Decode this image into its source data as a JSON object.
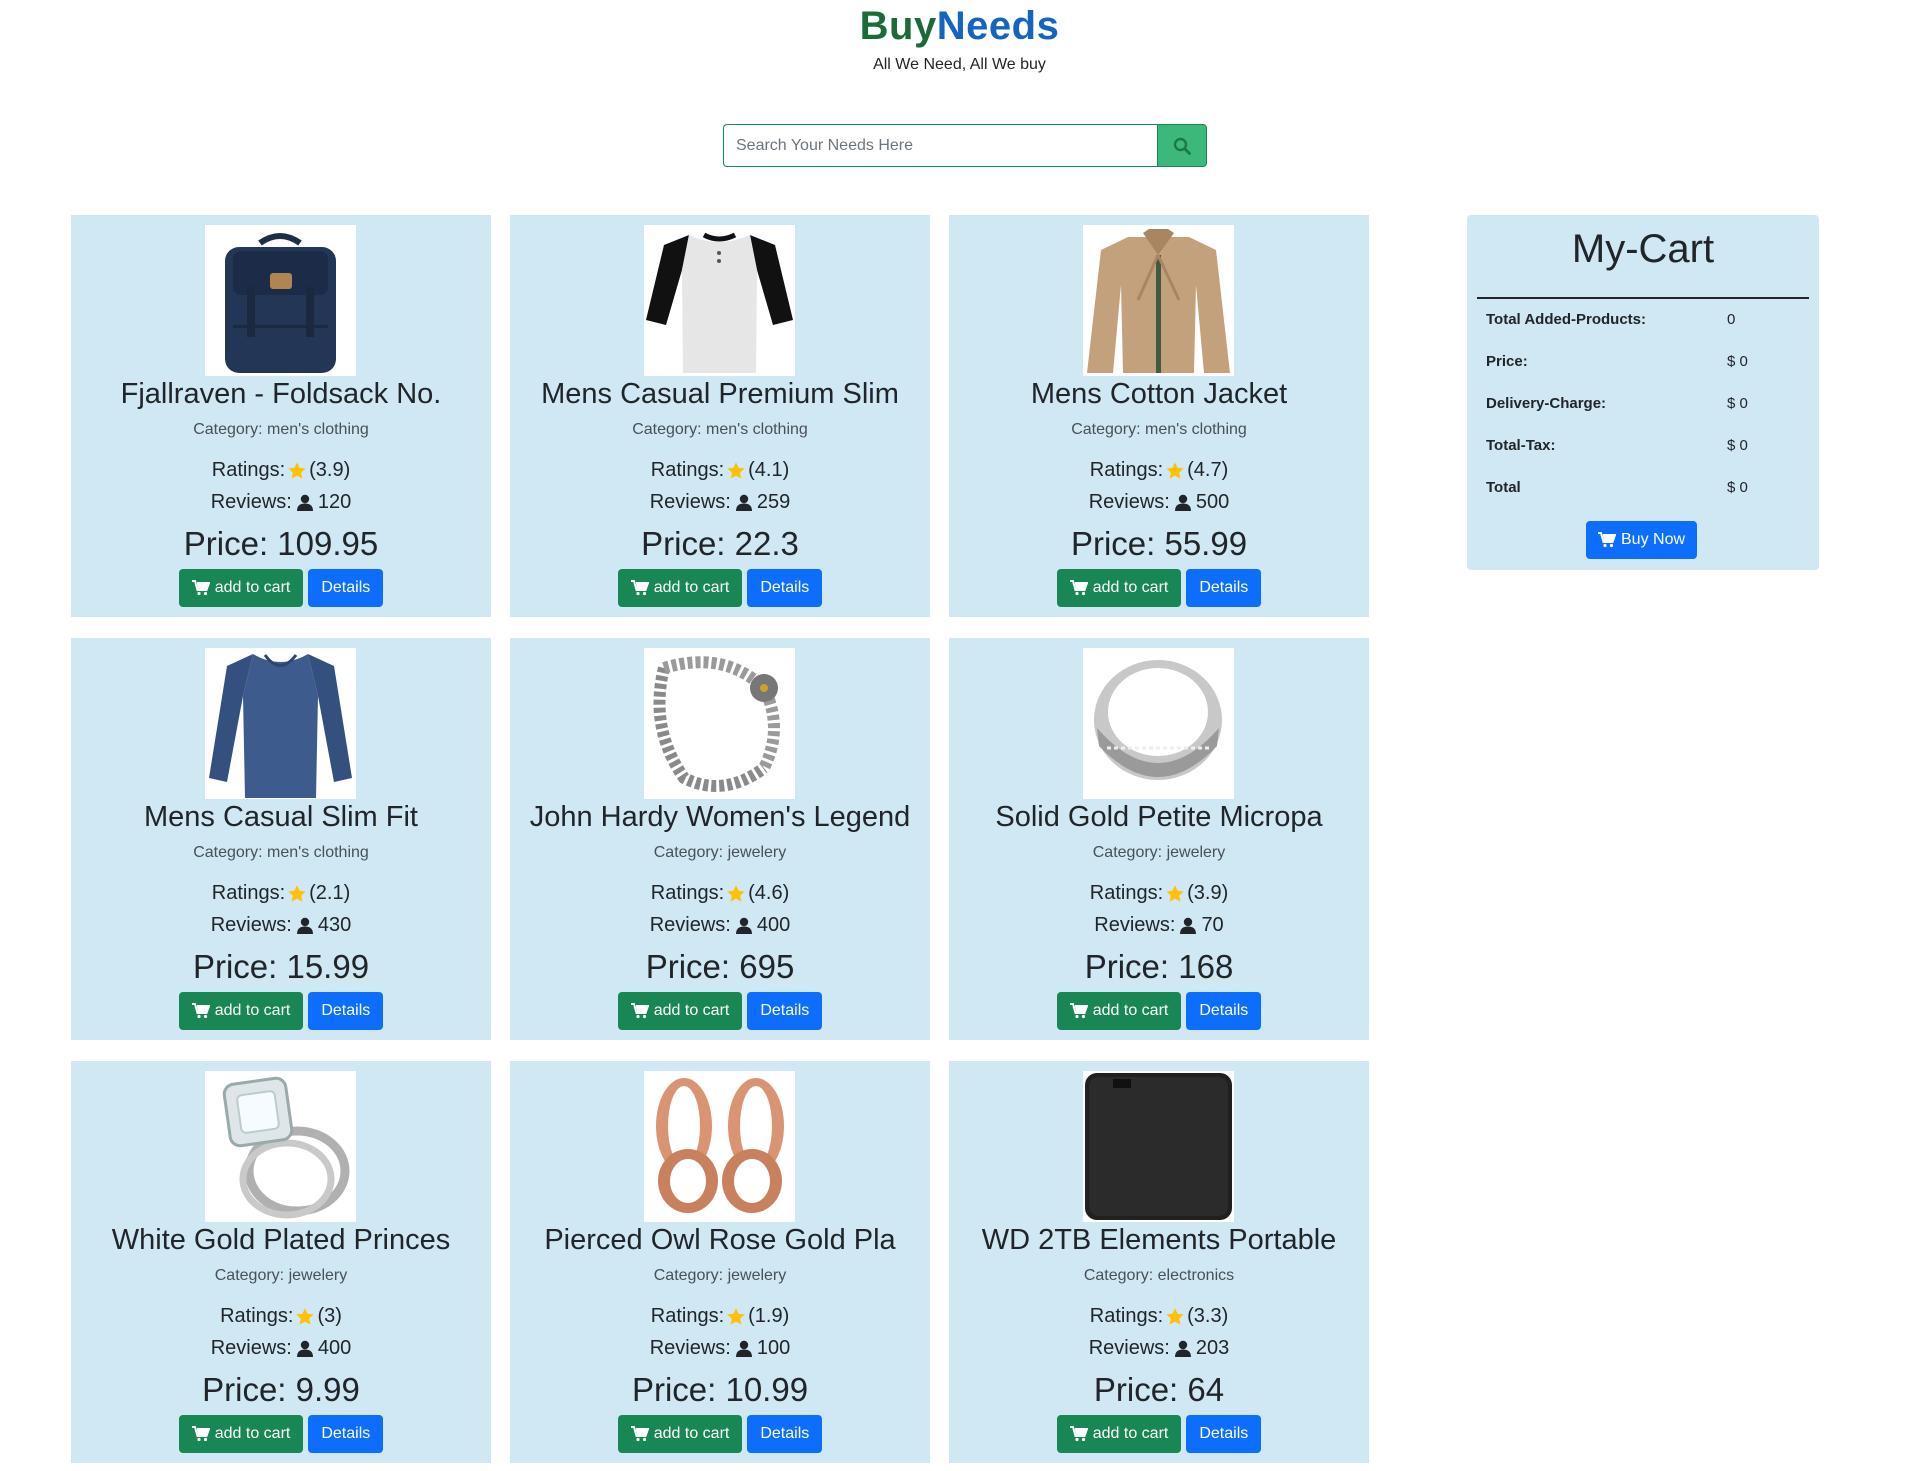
{
  "brand": {
    "part1": "Buy",
    "part2": "Needs",
    "tagline": "All We Need, All We buy",
    "color1": "#1b6b3a",
    "color2": "#1565c0"
  },
  "search": {
    "placeholder": "Search Your Needs Here",
    "button_icon": "search-icon"
  },
  "labels": {
    "ratings": "Ratings:",
    "reviews": "Reviews:",
    "price": "Price:",
    "add_to_cart": "add to cart",
    "details": "Details"
  },
  "products": [
    {
      "title": "Fjallraven - Foldsack No.",
      "category": "Category: men's clothing",
      "rating": "(3.9)",
      "reviews": "120",
      "price": "109.95",
      "image": "backpack"
    },
    {
      "title": "Mens Casual Premium Slim",
      "category": "Category: men's clothing",
      "rating": "(4.1)",
      "reviews": "259",
      "price": "22.3",
      "image": "raglan-tee"
    },
    {
      "title": "Mens Cotton Jacket",
      "category": "Category: men's clothing",
      "rating": "(4.7)",
      "reviews": "500",
      "price": "55.99",
      "image": "jacket"
    },
    {
      "title": "Mens Casual Slim Fit",
      "category": "Category: men's clothing",
      "rating": "(2.1)",
      "reviews": "430",
      "price": "15.99",
      "image": "long-sleeve-tee"
    },
    {
      "title": "John Hardy Women's Legend",
      "category": "Category: jewelery",
      "rating": "(4.6)",
      "reviews": "400",
      "price": "695",
      "image": "chain-bracelet"
    },
    {
      "title": "Solid Gold Petite Micropa",
      "category": "Category: jewelery",
      "rating": "(3.9)",
      "reviews": "70",
      "price": "168",
      "image": "ring"
    },
    {
      "title": "White Gold Plated Princes",
      "category": "Category: jewelery",
      "rating": "(3)",
      "reviews": "400",
      "price": "9.99",
      "image": "diamond-ring"
    },
    {
      "title": "Pierced Owl Rose Gold Pla",
      "category": "Category: jewelery",
      "rating": "(1.9)",
      "reviews": "100",
      "price": "10.99",
      "image": "ear-plugs"
    },
    {
      "title": "WD 2TB Elements Portable",
      "category": "Category: electronics",
      "rating": "(3.3)",
      "reviews": "203",
      "price": "64",
      "image": "hard-drive"
    }
  ],
  "cart": {
    "title": "My-Cart",
    "rows": [
      {
        "label": "Total Added-Products:",
        "value": "0"
      },
      {
        "label": "Price:",
        "value": "$ 0"
      },
      {
        "label": "Delivery-Charge:",
        "value": "$ 0"
      },
      {
        "label": "Total-Tax:",
        "value": "$ 0"
      },
      {
        "label": "Total",
        "value": "$ 0"
      }
    ],
    "buy_label": "Buy Now"
  },
  "colors": {
    "card_bg": "#cfe8f3",
    "cart_button": "#198754",
    "details_button": "#0d6efd",
    "star": "#ffc107"
  }
}
